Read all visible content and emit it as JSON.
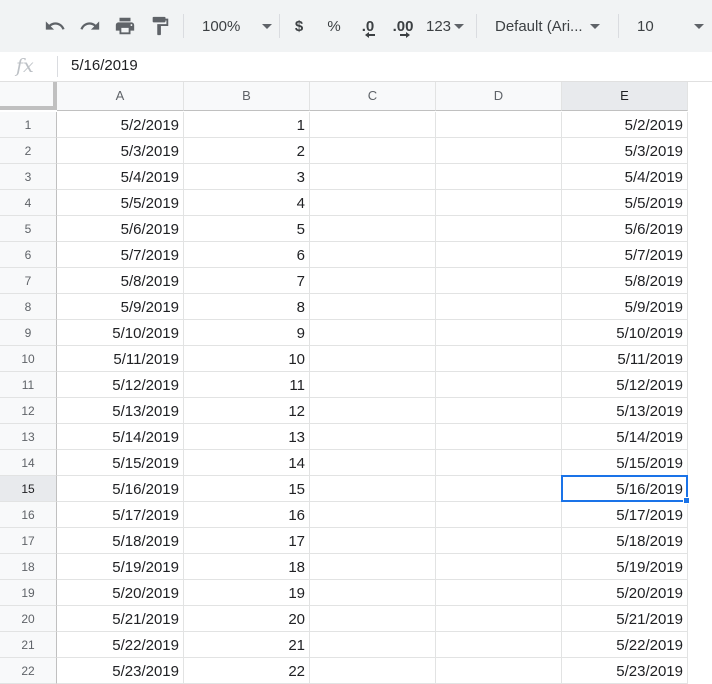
{
  "toolbar": {
    "zoom": "100%",
    "currency": "$",
    "percent": "%",
    "decrease_decimals": ".0",
    "increase_decimals": ".00",
    "more_formats": "123",
    "font": "Default (Ari...",
    "font_size": "10",
    "icons": [
      "undo-icon",
      "redo-icon",
      "print-icon",
      "paint-format-icon"
    ]
  },
  "formula_bar": {
    "fx_label": "fx",
    "value": "5/16/2019"
  },
  "columns": [
    "A",
    "B",
    "C",
    "D",
    "E"
  ],
  "active": {
    "row": 15,
    "column": "E"
  },
  "rows": [
    {
      "n": "1",
      "a": "5/2/2019",
      "b": "1",
      "e": "5/2/2019"
    },
    {
      "n": "2",
      "a": "5/3/2019",
      "b": "2",
      "e": "5/3/2019"
    },
    {
      "n": "3",
      "a": "5/4/2019",
      "b": "3",
      "e": "5/4/2019"
    },
    {
      "n": "4",
      "a": "5/5/2019",
      "b": "4",
      "e": "5/5/2019"
    },
    {
      "n": "5",
      "a": "5/6/2019",
      "b": "5",
      "e": "5/6/2019"
    },
    {
      "n": "6",
      "a": "5/7/2019",
      "b": "6",
      "e": "5/7/2019"
    },
    {
      "n": "7",
      "a": "5/8/2019",
      "b": "7",
      "e": "5/8/2019"
    },
    {
      "n": "8",
      "a": "5/9/2019",
      "b": "8",
      "e": "5/9/2019"
    },
    {
      "n": "9",
      "a": "5/10/2019",
      "b": "9",
      "e": "5/10/2019"
    },
    {
      "n": "10",
      "a": "5/11/2019",
      "b": "10",
      "e": "5/11/2019"
    },
    {
      "n": "11",
      "a": "5/12/2019",
      "b": "11",
      "e": "5/12/2019"
    },
    {
      "n": "12",
      "a": "5/13/2019",
      "b": "12",
      "e": "5/13/2019"
    },
    {
      "n": "13",
      "a": "5/14/2019",
      "b": "13",
      "e": "5/14/2019"
    },
    {
      "n": "14",
      "a": "5/15/2019",
      "b": "14",
      "e": "5/15/2019"
    },
    {
      "n": "15",
      "a": "5/16/2019",
      "b": "15",
      "e": "5/16/2019"
    },
    {
      "n": "16",
      "a": "5/17/2019",
      "b": "16",
      "e": "5/17/2019"
    },
    {
      "n": "17",
      "a": "5/18/2019",
      "b": "17",
      "e": "5/18/2019"
    },
    {
      "n": "18",
      "a": "5/19/2019",
      "b": "18",
      "e": "5/19/2019"
    },
    {
      "n": "19",
      "a": "5/20/2019",
      "b": "19",
      "e": "5/20/2019"
    },
    {
      "n": "20",
      "a": "5/21/2019",
      "b": "20",
      "e": "5/21/2019"
    },
    {
      "n": "21",
      "a": "5/22/2019",
      "b": "21",
      "e": "5/22/2019"
    },
    {
      "n": "22",
      "a": "5/23/2019",
      "b": "22",
      "e": "5/23/2019"
    }
  ]
}
